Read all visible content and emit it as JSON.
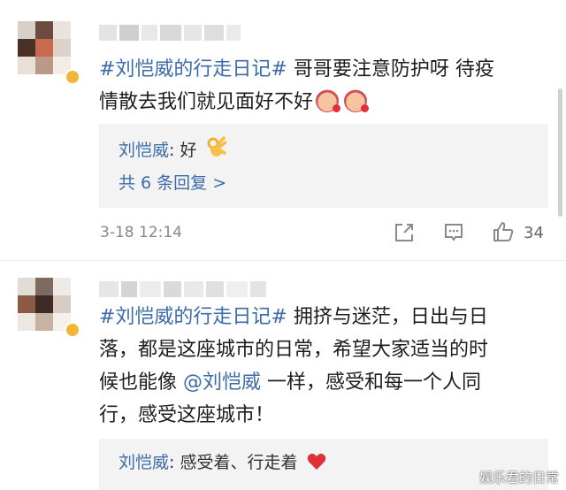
{
  "comments": [
    {
      "topic": "#刘恺威的行走日记#",
      "text_line1": " 哥哥要注意防护呀 待疫",
      "text_line2": "情散去我们就见面好不好",
      "emoji_icons": [
        "pig-sticker-icon",
        "pig-sticker-icon"
      ],
      "reply": {
        "name": "刘恺威",
        "colon": ":",
        "text": " 好",
        "icon": "ok-hand-icon",
        "more": "共 6 条回复 >"
      },
      "time": "3-18 12:14",
      "actions": {
        "share_icon": "share-icon",
        "comment_icon": "comment-icon",
        "like_icon": "thumbs-up-icon",
        "likes": "34"
      }
    },
    {
      "topic": "#刘恺威的行走日记#",
      "text_line1": " 拥挤与迷茫，日出与日",
      "text_line2": "落，都是这座城市的日常，希望大家适当的时",
      "text_line3_pre": "候也能像 ",
      "mention": "@刘恺威",
      "text_line3_post": " 一样，感受和每一个人同",
      "text_line4": "行，感受这座城市！",
      "reply": {
        "name": "刘恺威",
        "colon": ":",
        "text": " 感受着、行走着",
        "icon": "red-heart-icon"
      }
    }
  ],
  "watermark": "娱乐君的日常",
  "colors": {
    "link": "#3b6ba8",
    "reply_bg": "#f3f3f3",
    "meta": "#888888"
  }
}
